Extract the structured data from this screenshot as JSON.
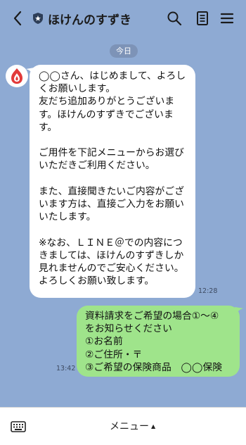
{
  "header": {
    "title": "ほけんのすずき",
    "back_icon": "back-chevron-icon",
    "badge_icon": "shield-icon",
    "actions": [
      "search-icon",
      "notes-icon",
      "menu-icon"
    ]
  },
  "chat": {
    "date_label": "今日",
    "incoming": {
      "text": "◯◯さん、はじめまして、よろしくお願いします。\n友だち追加ありがとうございます。ほけんのすずきでございます。\n\nご用件を下記メニューからお選びいただきご利用ください。\n\nまた、直接聞きたいご内容がございます方は、直接ご入力をお願いいたします。\n\n※なお、ＬＩＮＥ＠での内容につきましては、ほけんのすずきしか見れませんのでご安心ください。\nよろしくお願い致します。",
      "time": "12:28"
    },
    "outgoing": {
      "text": "資料請求をご希望の場合①〜④\nをお知らせください\n①お名前\n②ご住所・〒\n③ご希望の保険商品　◯◯保険",
      "time": "13:42"
    }
  },
  "footer": {
    "menu_label": "メニュー",
    "caret": "▲",
    "keyboard_icon": "keyboard-icon"
  },
  "colors": {
    "background": "#8eaad3",
    "incoming_bubble": "#ffffff",
    "outgoing_bubble": "#9fe48b",
    "date_pill": "#7d93b7"
  }
}
